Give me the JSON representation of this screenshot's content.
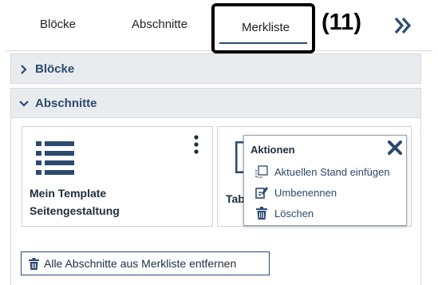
{
  "tabs": [
    {
      "label": "Blöcke"
    },
    {
      "label": "Abschnitte"
    },
    {
      "label": "Merkliste",
      "active": true
    }
  ],
  "callout": "(11)",
  "sections": {
    "bloecke": {
      "label": "Blöcke",
      "expanded": false
    },
    "abschnitte": {
      "label": "Abschnitte",
      "expanded": true
    }
  },
  "cards": [
    {
      "title": "Mein Template Seitengestaltung",
      "icon": "list-icon"
    },
    {
      "title": "Tab",
      "icon": "template-icon"
    }
  ],
  "popup": {
    "title": "Aktionen",
    "items": [
      {
        "label": "Aktuellen Stand einfügen",
        "icon": "insert-icon"
      },
      {
        "label": "Umbenennen",
        "icon": "edit-icon"
      },
      {
        "label": "Löschen",
        "icon": "trash-icon"
      }
    ]
  },
  "remove_button": {
    "label": "Alle Abschnitte aus Merkliste entfernen",
    "icon": "trash-icon"
  },
  "colors": {
    "accent": "#2c4a6e",
    "header_bg": "#e9ecef",
    "border": "#d5d9de"
  }
}
